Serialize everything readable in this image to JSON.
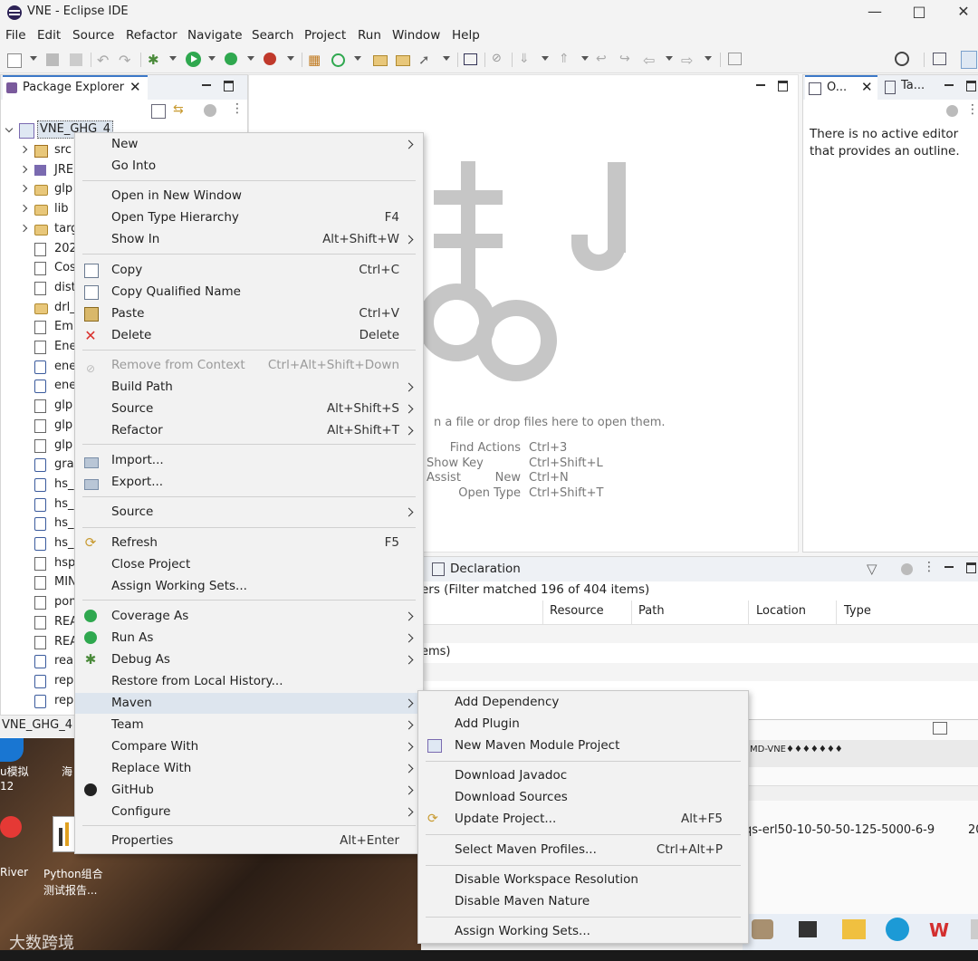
{
  "window": {
    "title": "VNE - Eclipse IDE"
  },
  "menubar": [
    "File",
    "Edit",
    "Source",
    "Refactor",
    "Navigate",
    "Search",
    "Project",
    "Run",
    "Window",
    "Help"
  ],
  "package_explorer": {
    "tab_label": "Package Explorer",
    "project": "VNE_GHG_4",
    "items": [
      "src",
      "JRE",
      "glp",
      "lib",
      "targ",
      "202",
      "Cos",
      "dist",
      "drl_",
      "Eml",
      "Ene",
      "ene",
      "ene",
      "glp",
      "glp",
      "glp",
      "gra",
      "hs_",
      "hs_",
      "hs_",
      "hs_",
      "hsp",
      "MIN",
      "pom",
      "REA",
      "REA",
      "rea",
      "rep",
      "rep"
    ],
    "status_label": "VNE_GHG_4"
  },
  "outline": {
    "tab1": "O...",
    "tab2": "Ta...",
    "message": "There is no active editor that provides an outline."
  },
  "editor_area": {
    "drop_hint": "n a file or drop files here to open them.",
    "shortcuts": [
      {
        "label": "Find Actions",
        "key": "Ctrl+3"
      },
      {
        "label": "Show Key Assist",
        "key": "Ctrl+Shift+L"
      },
      {
        "label": "New",
        "key": "Ctrl+N"
      },
      {
        "label": "Open Type",
        "key": "Ctrl+Shift+T"
      }
    ]
  },
  "problems_view": {
    "tab_label": "Declaration",
    "filter_text": "ers (Filter matched 196 of 404 items)",
    "columns": [
      "Resource",
      "Path",
      "Location",
      "Type"
    ],
    "row_text": "ems)"
  },
  "background_texts": {
    "console_line": "MD-VNE♦♦♦♦♦♦♦",
    "console_line2": "qs-erl50-10-50-50-125-5000-6-9",
    "console_suffix": "20"
  },
  "desktop": {
    "icon1_label_a": "u模拟",
    "icon1_label_b": "12",
    "icon2_label": "海",
    "icon3_label": "River",
    "icon4_label_a": "Python组合",
    "icon4_label_b": "测试报告...",
    "watermark": "大数跨境"
  },
  "context_menu": {
    "items": [
      {
        "label": "New",
        "accel": "",
        "sub": true
      },
      {
        "label": "Go Into",
        "accel": "",
        "sub": false
      },
      {
        "label": "Open in New Window",
        "accel": "",
        "sub": false
      },
      {
        "label": "Open Type Hierarchy",
        "accel": "F4",
        "sub": false
      },
      {
        "label": "Show In",
        "accel": "Alt+Shift+W",
        "sub": true
      },
      {
        "label": "Copy",
        "accel": "Ctrl+C",
        "sub": false
      },
      {
        "label": "Copy Qualified Name",
        "accel": "",
        "sub": false
      },
      {
        "label": "Paste",
        "accel": "Ctrl+V",
        "sub": false
      },
      {
        "label": "Delete",
        "accel": "Delete",
        "sub": false
      },
      {
        "label": "Remove from Context",
        "accel": "Ctrl+Alt+Shift+Down",
        "sub": false
      },
      {
        "label": "Build Path",
        "accel": "",
        "sub": true
      },
      {
        "label": "Source",
        "accel": "Alt+Shift+S",
        "sub": true
      },
      {
        "label": "Refactor",
        "accel": "Alt+Shift+T",
        "sub": true
      },
      {
        "label": "Import...",
        "accel": "",
        "sub": false
      },
      {
        "label": "Export...",
        "accel": "",
        "sub": false
      },
      {
        "label": "Source",
        "accel": "",
        "sub": true
      },
      {
        "label": "Refresh",
        "accel": "F5",
        "sub": false
      },
      {
        "label": "Close Project",
        "accel": "",
        "sub": false
      },
      {
        "label": "Assign Working Sets...",
        "accel": "",
        "sub": false
      },
      {
        "label": "Coverage As",
        "accel": "",
        "sub": true
      },
      {
        "label": "Run As",
        "accel": "",
        "sub": true
      },
      {
        "label": "Debug As",
        "accel": "",
        "sub": true
      },
      {
        "label": "Restore from Local History...",
        "accel": "",
        "sub": false
      },
      {
        "label": "Maven",
        "accel": "",
        "sub": true
      },
      {
        "label": "Team",
        "accel": "",
        "sub": true
      },
      {
        "label": "Compare With",
        "accel": "",
        "sub": true
      },
      {
        "label": "Replace With",
        "accel": "",
        "sub": true
      },
      {
        "label": "GitHub",
        "accel": "",
        "sub": true
      },
      {
        "label": "Configure",
        "accel": "",
        "sub": true
      },
      {
        "label": "Properties",
        "accel": "Alt+Enter",
        "sub": false
      }
    ]
  },
  "maven_submenu": {
    "items": [
      {
        "label": "Add Dependency",
        "accel": ""
      },
      {
        "label": "Add Plugin",
        "accel": ""
      },
      {
        "label": "New Maven Module Project",
        "accel": ""
      },
      {
        "label": "Download Javadoc",
        "accel": ""
      },
      {
        "label": "Download Sources",
        "accel": ""
      },
      {
        "label": "Update Project...",
        "accel": "Alt+F5"
      },
      {
        "label": "Select Maven Profiles...",
        "accel": "Ctrl+Alt+P"
      },
      {
        "label": "Disable Workspace Resolution",
        "accel": ""
      },
      {
        "label": "Disable Maven Nature",
        "accel": ""
      },
      {
        "label": "Assign Working Sets...",
        "accel": ""
      }
    ]
  },
  "colors": {
    "accent": "#3c78c8",
    "highlight": "#dde5ee",
    "delete_red": "#d9302c",
    "run_green": "#2fa84f"
  }
}
